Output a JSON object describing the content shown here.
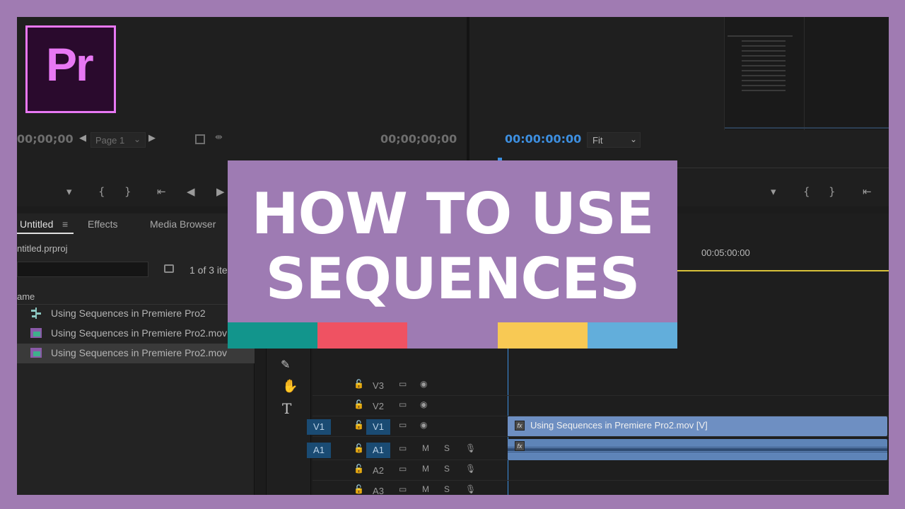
{
  "source_monitor": {
    "timecode_left": "00;00;00",
    "page_label": "Page 1",
    "timecode_right": "00;00;00;00"
  },
  "program_monitor": {
    "timecode": "00:00:00:00",
    "fit_label": "Fit"
  },
  "project_panel": {
    "tabs": [
      "Untitled",
      "Effects",
      "Media Browser"
    ],
    "project_file": "ntitled.prproj",
    "item_count": "1 of 3 ite",
    "column_name": "ame",
    "items": [
      {
        "label": "Using Sequences in Premiere Pro2"
      },
      {
        "label": "Using Sequences in Premiere Pro2.mov"
      },
      {
        "label": "Using Sequences in Premiere Pro2.mov"
      }
    ]
  },
  "timeline": {
    "ruler_time": "00:05:00:00",
    "video_tracks": [
      {
        "name": "V3",
        "src": ""
      },
      {
        "name": "V2",
        "src": ""
      },
      {
        "name": "V1",
        "src": "V1"
      }
    ],
    "audio_tracks": [
      {
        "name": "A1",
        "src": "A1"
      },
      {
        "name": "A2",
        "src": ""
      },
      {
        "name": "A3",
        "src": ""
      }
    ],
    "mute_label": "M",
    "solo_label": "S",
    "video_clip": "Using Sequences in Premiere Pro2.mov [V]",
    "fx_label": "fx"
  },
  "overlay": {
    "logo_text": "Pr",
    "title_line1": "HOW TO USE",
    "title_line2": "SEQUENCES",
    "color_bars": [
      "#12958c",
      "#ef5262",
      "#9e7bb3",
      "#f8c954",
      "#62aedb"
    ]
  },
  "colors": {
    "timecode_blue": "#3d8fe0",
    "clip_video": "#6e8fc2",
    "clip_audio": "#5e84b8",
    "track_target": "#1a4b73",
    "accent_yellow": "#d8c23a"
  }
}
